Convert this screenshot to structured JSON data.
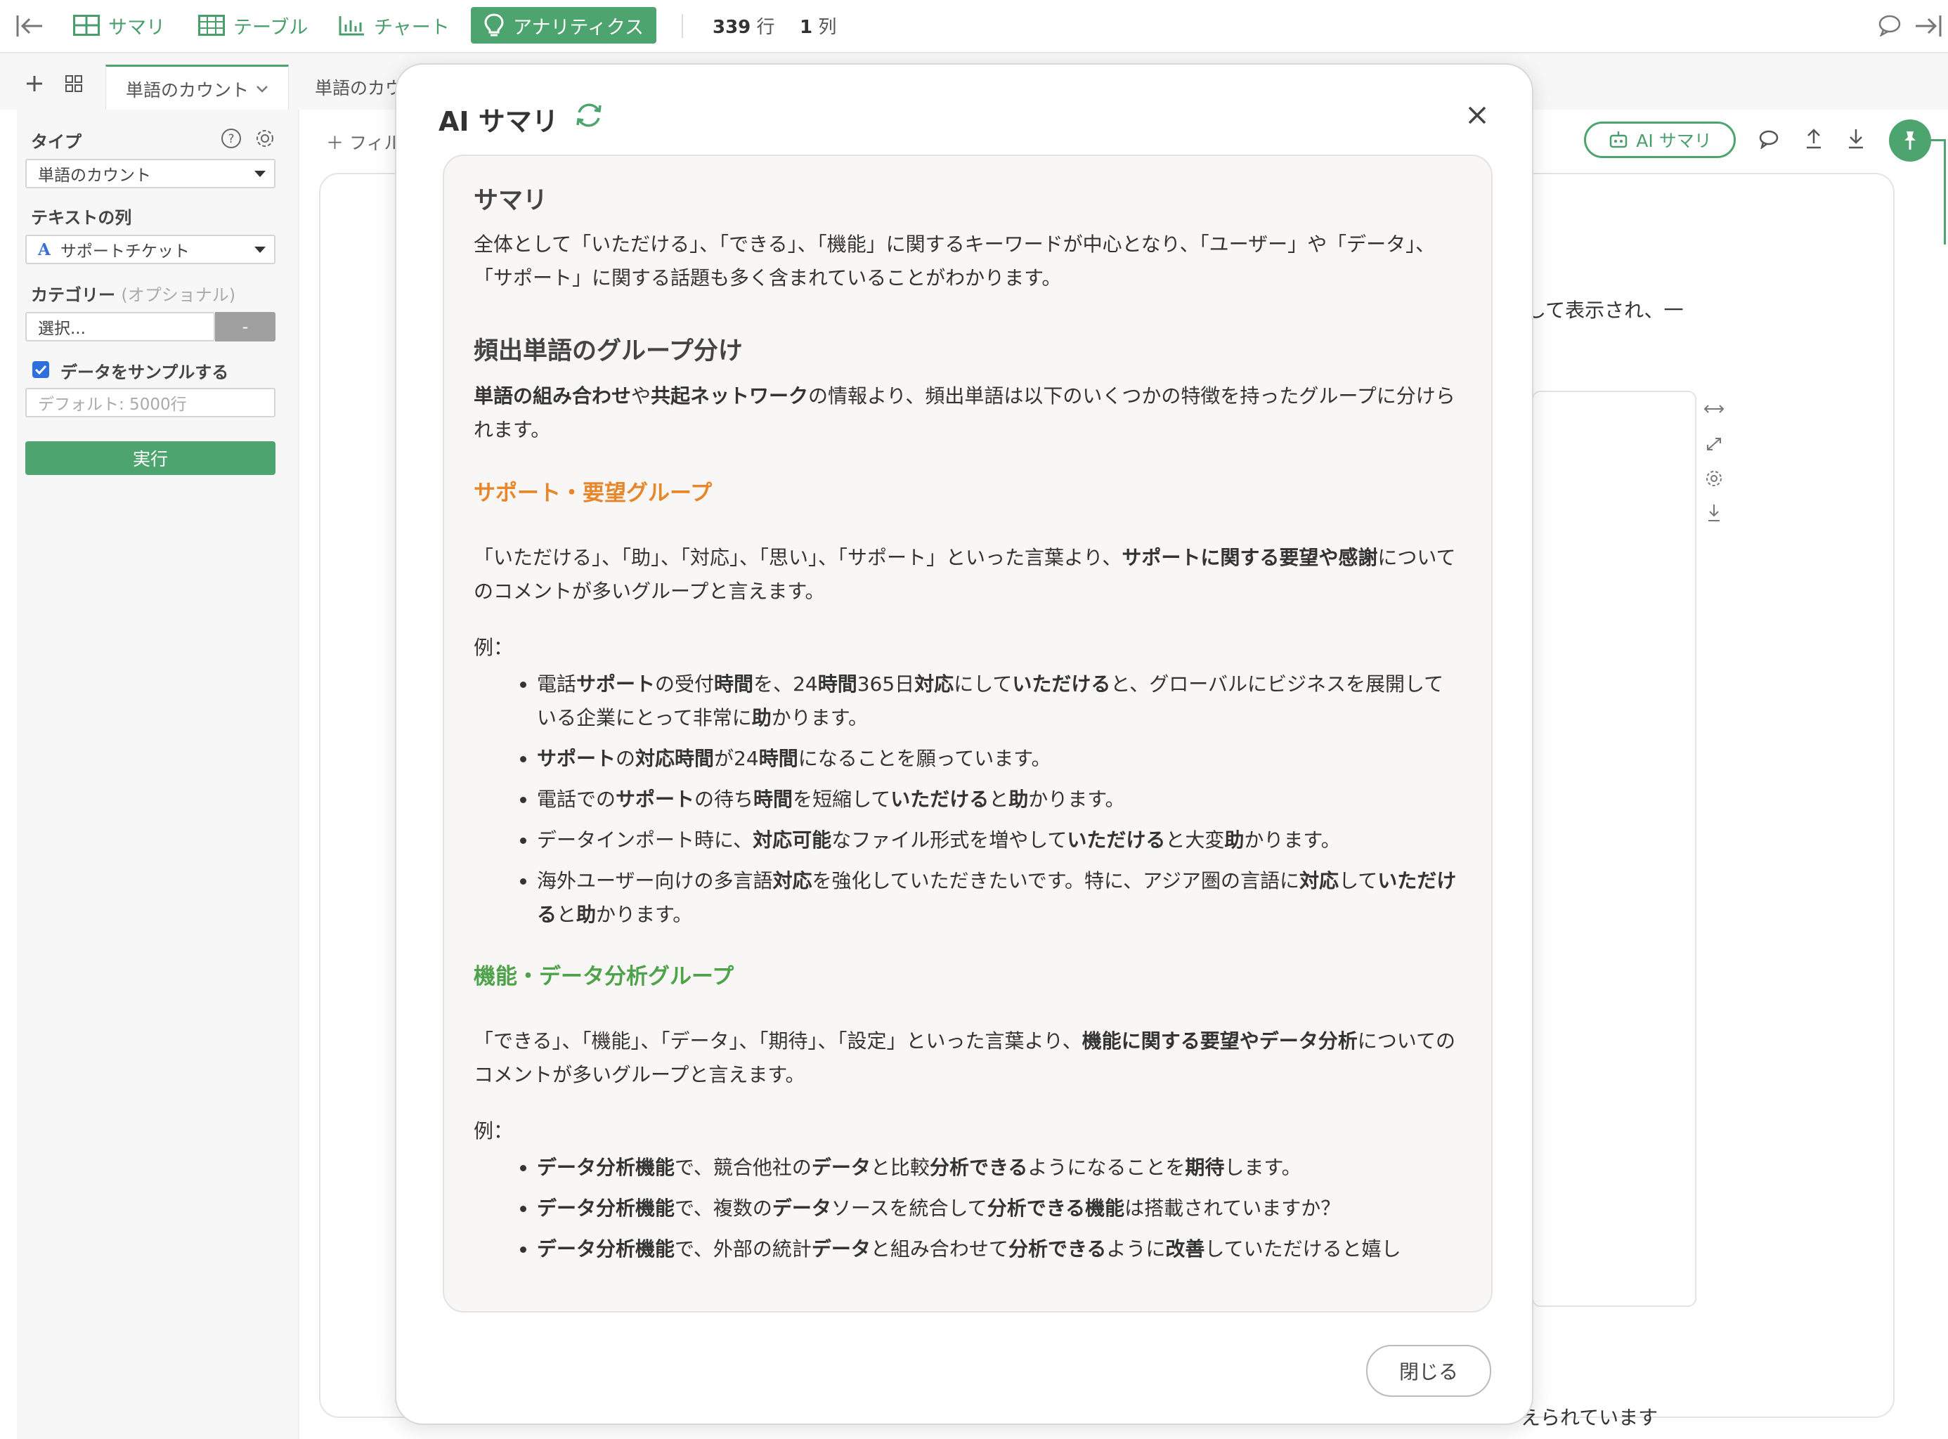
{
  "toolbar": {
    "summary": "サマリ",
    "table": "テーブル",
    "chart": "チャート",
    "analytics": "アナリティクス",
    "rows_value": "339",
    "rows_unit": "行",
    "cols_value": "1",
    "cols_unit": "列"
  },
  "tabs": [
    "単語のカウント",
    "単語のカウ"
  ],
  "sidebar": {
    "type_label": "タイプ",
    "type_value": "単語のカウント",
    "text_col_label": "テキストの列",
    "text_col_value": "サポートチケット",
    "category_label": "カテゴリー",
    "category_optional": "(オプショナル)",
    "category_placeholder": "選択...",
    "category_button": "-",
    "sample_label": "データをサンプルする",
    "sample_placeholder": "デフォルト: 5000行",
    "run_button": "実行"
  },
  "background": {
    "filter": "フィル",
    "ai_summary_button": "AI サマリ",
    "text_fragment": "して表示され、一",
    "bottom_fragment": "えられています"
  },
  "modal": {
    "title": "AI サマリ",
    "close_button": "閉じる",
    "summary_heading": "サマリ",
    "summary_text": "全体として「いただける」、「できる」、「機能」に関するキーワードが中心となり、「ユーザー」や「データ」、「サポート」に関する話題も多く含まれていることがわかります。",
    "group_heading": "頻出単語のグループ分け",
    "group_intro_bold1": "単語の組み合わせ",
    "group_intro_1": "や",
    "group_intro_bold2": "共起ネットワーク",
    "group_intro_2": "の情報より、頻出単語は以下のいくつかの特徴を持ったグループに分けられます。",
    "support_heading": "サポート・要望グループ",
    "support_text": "「いただける」、「助」、「対応」、「思い」、「サポート」といった言葉より、",
    "support_bold": "サポートに関する要望や感謝",
    "support_text2": "についてのコメントが多いグループと言えます。",
    "example_label": "例：",
    "support_examples": [
      "電話サポートの受付時間を、24時間365日対応にしていただけると、グローバルにビジネスを展開している企業にとって非常に助かります。",
      "サポートの対応時間が24時間になることを願っています。",
      "電話でのサポートの待ち時間を短縮していただけると助かります。",
      "データインポート時に、対応可能なファイル形式を増やしていただけると大変助かります。",
      "海外ユーザー向けの多言語対応を強化していただきたいです。特に、アジア圏の言語に対応していただけると助かります。"
    ],
    "feature_heading": "機能・データ分析グループ",
    "feature_text": "「できる」、「機能」、「データ」、「期待」、「設定」といった言葉より、",
    "feature_bold": "機能に関する要望やデータ分析",
    "feature_text2": "についてのコメントが多いグループと言えます。",
    "feature_examples": [
      "データ分析機能で、競合他社のデータと比較分析できるようになることを期待します。",
      "データ分析機能で、複数のデータソースを統合して分析できる機能は搭載されていますか？",
      "データ分析機能で、外部の統計データと組み合わせて分析できるように改善していただけると嬉し"
    ]
  },
  "colors": {
    "accent": "#4ea46f",
    "orange_heading": "#e8862a",
    "green_heading": "#4ea24a"
  }
}
